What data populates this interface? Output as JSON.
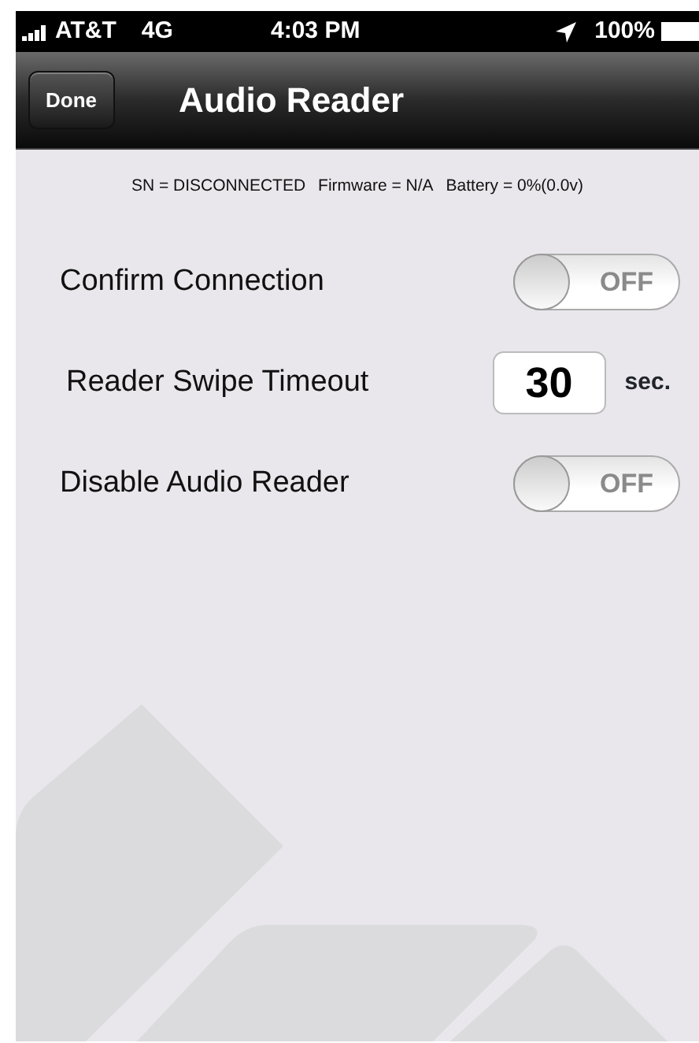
{
  "status_bar": {
    "carrier": "AT&T",
    "network": "4G",
    "time": "4:03 PM",
    "battery": "100%"
  },
  "nav_bar": {
    "button": "Done",
    "title": "Audio Reader"
  },
  "info": [
    "SN = DISCONNECTED",
    "Firmware = N/A",
    "Battery = 0%(0.0v)"
  ],
  "settings": [
    {
      "kind": "toggle",
      "label": "Confirm Connection",
      "on": false,
      "state_label": "OFF"
    },
    {
      "kind": "number",
      "label": "Reader Swipe Timeout",
      "value": "30",
      "unit": "sec."
    },
    {
      "kind": "toggle",
      "label": "Disable Audio Reader",
      "on": false,
      "state_label": "OFF"
    }
  ]
}
